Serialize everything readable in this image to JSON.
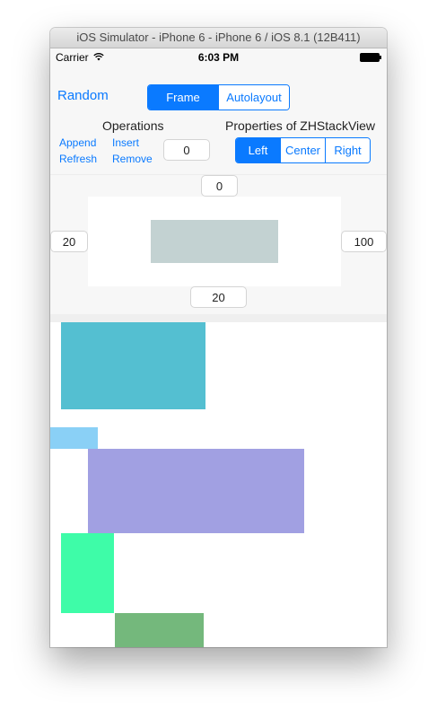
{
  "window": {
    "title": "iOS Simulator - iPhone 6 - iPhone 6 / iOS 8.1 (12B411)"
  },
  "status_bar": {
    "carrier": "Carrier",
    "time": "6:03 PM",
    "icons": [
      "wifi-icon",
      "battery-icon"
    ]
  },
  "toolbar": {
    "random_label": "Random",
    "mode_segments": [
      "Frame",
      "Autolayout"
    ],
    "mode_selected": "Frame"
  },
  "operations": {
    "title": "Operations",
    "append_label": "Append",
    "insert_label": "Insert",
    "refresh_label": "Refresh",
    "remove_label": "Remove",
    "index_value": "0"
  },
  "properties": {
    "title": "Properties of ZHStackView",
    "alignment_segments": [
      "Left",
      "Center",
      "Right"
    ],
    "alignment_selected": "Left"
  },
  "insets": {
    "top": "0",
    "left": "20",
    "right": "100",
    "bottom": "20"
  },
  "colors": {
    "accent": "#0a7aff",
    "preview_item": "#c3d2d2",
    "block_1": "#54bfd1",
    "block_2": "#8ad0f6",
    "block_3": "#a1a0e2",
    "block_4": "#3efca8",
    "block_5": "#74b87c"
  }
}
